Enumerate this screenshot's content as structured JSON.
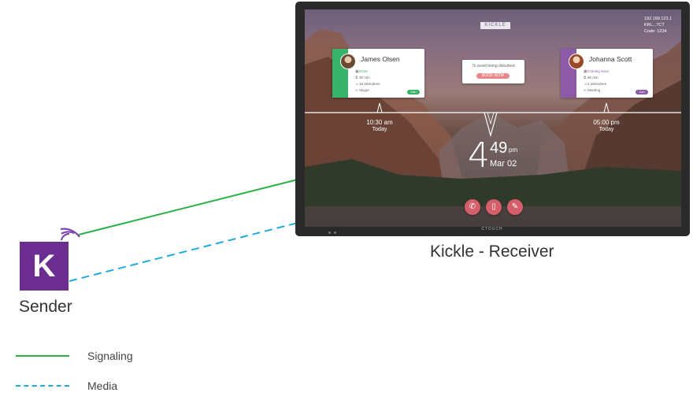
{
  "sender": {
    "logo_letter": "K",
    "label": "Sender"
  },
  "receiver": {
    "label": "Kickle - Receiver",
    "display_brand": "CTOUCH",
    "screen": {
      "app_logo": "KICKLE",
      "connection": [
        "192.168.123.1",
        "KRL...7CT",
        "Code: 1234"
      ],
      "meeting_left": {
        "name": "James Olsen",
        "rows": [
          "Done",
          "30 min",
          "15 attendees",
          "Skype"
        ],
        "action": "Join",
        "accent": "#39b36a"
      },
      "meeting_center": {
        "message": "To avoid being disturbed",
        "button": "BOOK NOW"
      },
      "meeting_right": {
        "name": "Johanna Scott",
        "rows": [
          "Coming soon",
          "60 min",
          "2 attendees",
          "Meeting"
        ],
        "action": "Join",
        "accent": "#8d5aa8"
      },
      "timeline_left": {
        "time": "10:30 am",
        "day": "Today"
      },
      "timeline_right": {
        "time": "05:00 pm",
        "day": "Today"
      },
      "clock": {
        "hour": "4",
        "minutes": "49",
        "ampm": "pm",
        "date": "Mar 02"
      },
      "dock_icons": [
        "phone-icon",
        "book-icon",
        "pen-icon"
      ]
    }
  },
  "legend": [
    {
      "label": "Signaling",
      "color": "#2bb04a",
      "style": "solid"
    },
    {
      "label": "Media",
      "color": "#22a9e0",
      "style": "dashed"
    }
  ]
}
